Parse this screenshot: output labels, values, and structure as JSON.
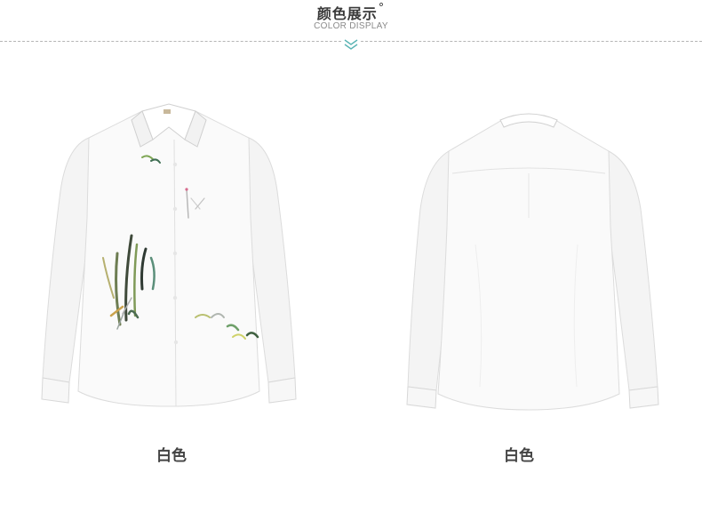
{
  "header": {
    "title": "颜色展示",
    "title_mark": "°",
    "subtitle": "COLOR DISPLAY",
    "accent_color": "#5ab4b4"
  },
  "products": [
    {
      "view": "front",
      "color_label": "白色",
      "icon": "shirt-front-icon"
    },
    {
      "view": "back",
      "color_label": "白色",
      "icon": "shirt-back-icon"
    }
  ]
}
